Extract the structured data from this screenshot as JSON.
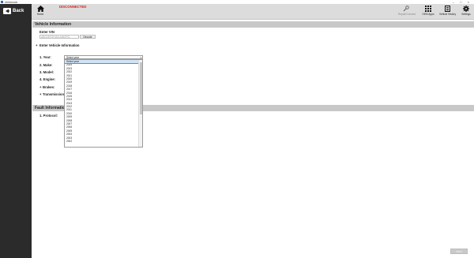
{
  "window": {
    "title": "vIntecom",
    "controls": "– □ ×"
  },
  "sidebar": {
    "back_label": "Back"
  },
  "toolbar": {
    "home_label": "Home",
    "status": "DISCONNECTED",
    "status_color": "#e21b1b",
    "repair_label": "Repair/Connect",
    "apps_label": "OEM Apps",
    "history_label": "Vehicle History",
    "settings_label": "Settings"
  },
  "vehicle_info": {
    "header": "Vehicle Information",
    "enter_vin_label": "Enter VIN",
    "vin_placeholder": "ABCDEFGHIJKLMNOPQ",
    "decode_label": "Decode",
    "enter_vehicle_info_label": "Enter Vehicle Information",
    "fields": {
      "year": "1. Year:",
      "make": "2. Make:",
      "model": "3. Model:",
      "engine": "4. Engine:",
      "brakes": "Brakes:",
      "transmissions": "Transmissions:"
    },
    "year_select_value": "Select year",
    "year_options": [
      "Select year",
      "2024",
      "2023",
      "2022",
      "2021",
      "2020",
      "2019",
      "2018",
      "2017",
      "2016",
      "2015",
      "2014",
      "2013",
      "2012",
      "2011",
      "2010",
      "2009",
      "2008",
      "2007",
      "2006",
      "2005",
      "2004",
      "2003",
      "2002"
    ]
  },
  "fault_info": {
    "header": "Fault Information",
    "protocol_label": "1. Protocol:"
  },
  "footer": {
    "next_label": "Next"
  }
}
